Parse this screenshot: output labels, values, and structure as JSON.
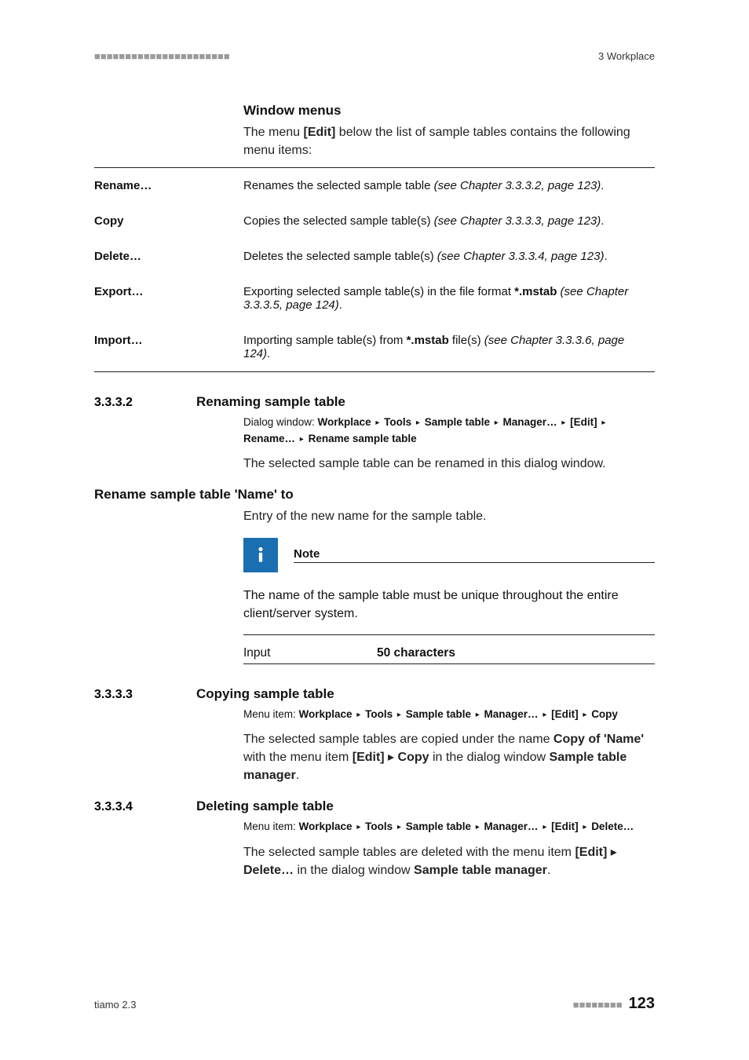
{
  "header": {
    "left_marker": "■■■■■■■■■■■■■■■■■■■■■■",
    "right": "3 Workplace"
  },
  "intro": {
    "heading": "Window menus",
    "text_pre": "The menu ",
    "text_bold": "[Edit]",
    "text_post": " below the list of sample tables contains the following menu items:"
  },
  "menu": {
    "rows": [
      {
        "label": "Rename…",
        "desc_pre": "Renames the selected sample table ",
        "desc_italic": "(see Chapter 3.3.3.2, page 123)",
        "desc_post": "."
      },
      {
        "label": "Copy",
        "desc_pre": "Copies the selected sample table(s) ",
        "desc_italic": "(see Chapter 3.3.3.3, page 123)",
        "desc_post": "."
      },
      {
        "label": "Delete…",
        "desc_pre": "Deletes the selected sample table(s) ",
        "desc_italic": "(see Chapter 3.3.3.4, page 123)",
        "desc_post": "."
      },
      {
        "label": "Export…",
        "desc_pre": "Exporting selected sample table(s) in the file format ",
        "desc_bold": "*.mstab",
        "desc_mid": " ",
        "desc_italic": "(see Chapter 3.3.3.5, page 124)",
        "desc_post": "."
      },
      {
        "label": "Import…",
        "desc_pre": "Importing sample table(s) from ",
        "desc_bold": "*.mstab",
        "desc_mid": " file(s) ",
        "desc_italic": "(see Chapter 3.3.3.6, page 124)",
        "desc_post": "."
      }
    ]
  },
  "sec_3332": {
    "num": "3.3.3.2",
    "title": "Renaming sample table",
    "bc_lbl": "Dialog window: ",
    "bc_parts": [
      "Workplace",
      "Tools",
      "Sample table",
      "Manager…",
      "[Edit]",
      "Rename…",
      "Rename sample table"
    ],
    "body": "The selected sample table can be renamed in this dialog window.",
    "sub_h": "Rename sample table 'Name' to",
    "sub_body": "Entry of the new name for the sample table.",
    "note_title": "Note",
    "note_body": "The name of the sample table must be unique throughout the entire client/server system.",
    "input_label": "Input",
    "input_value": "50 characters"
  },
  "sec_3333": {
    "num": "3.3.3.3",
    "title": "Copying sample table",
    "bc_lbl": "Menu item: ",
    "bc_parts": [
      "Workplace",
      "Tools",
      "Sample table",
      "Manager…",
      "[Edit]",
      "Copy"
    ],
    "body_1": "The selected sample tables are copied under the name ",
    "body_b1": "Copy of 'Name'",
    "body_2": " with the menu item ",
    "body_b2": "[Edit]",
    "body_tri": " ▸ ",
    "body_b3": "Copy",
    "body_3": " in the dialog window ",
    "body_b4": "Sample table manager",
    "body_4": "."
  },
  "sec_3334": {
    "num": "3.3.3.4",
    "title": "Deleting sample table",
    "bc_lbl": "Menu item: ",
    "bc_parts": [
      "Workplace",
      "Tools",
      "Sample table",
      "Manager…",
      "[Edit]",
      "Delete…"
    ],
    "body_1": "The selected sample tables are deleted with the menu item ",
    "body_b1": "[Edit]",
    "body_tri": " ▸ ",
    "body_b2": "Delete…",
    "body_2": " in the dialog window ",
    "body_b3": "Sample table manager",
    "body_3": "."
  },
  "footer": {
    "left": "tiamo 2.3",
    "dots": "■■■■■■■■",
    "page": "123"
  },
  "glyph": {
    "tri": "▸"
  }
}
